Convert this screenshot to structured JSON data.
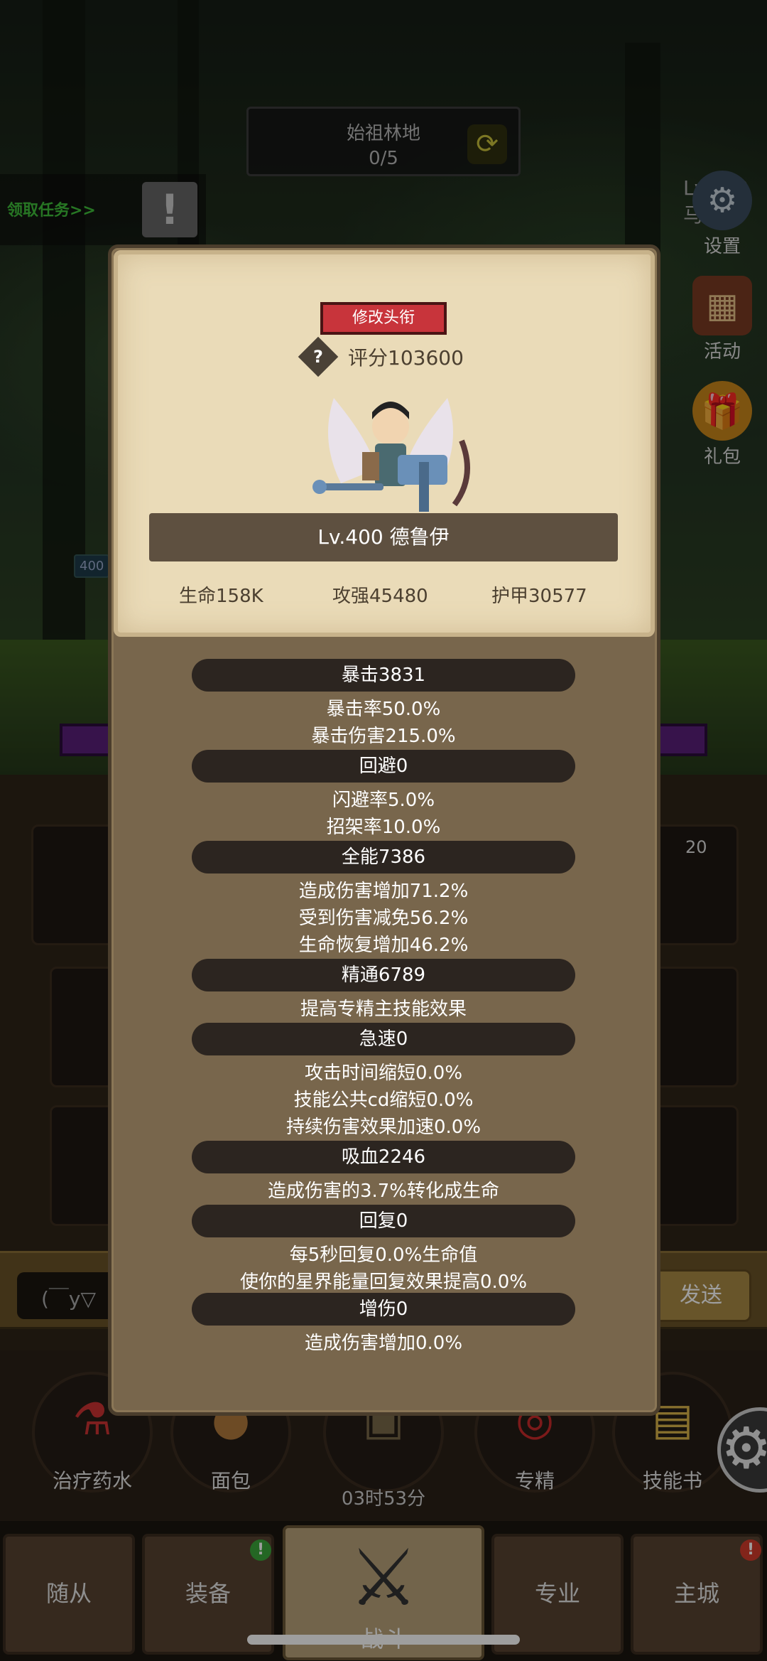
{
  "zone": {
    "title": "始祖林地",
    "progress": "0/5"
  },
  "task": {
    "label": "领取任务>>"
  },
  "player_level": "Lv.352 马",
  "side_menu": [
    {
      "label": "设置"
    },
    {
      "label": "活动"
    },
    {
      "label": "礼包"
    }
  ],
  "scene_badge": "400",
  "slot_count": "20",
  "chat": {
    "input_text": "(￣y▽",
    "send_label": "发送"
  },
  "items": [
    {
      "label": "治疗药水"
    },
    {
      "label": "面包"
    },
    {
      "label": "专精"
    },
    {
      "label": "技能书"
    }
  ],
  "timer": "03时53分",
  "tabs": [
    {
      "label": "随从"
    },
    {
      "label": "装备"
    },
    {
      "label": "战斗"
    },
    {
      "label": "专业"
    },
    {
      "label": "主城"
    }
  ],
  "modal": {
    "rename_label": "修改头衔",
    "score": "评分103600",
    "hero_name": "Lv.400 德鲁伊",
    "top_stats": [
      "生命158K",
      "攻强45480",
      "护甲30577"
    ],
    "sections": [
      {
        "title": "暴击3831",
        "lines": [
          "暴击率50.0%",
          "暴击伤害215.0%"
        ]
      },
      {
        "title": "回避0",
        "lines": [
          "闪避率5.0%",
          "招架率10.0%"
        ]
      },
      {
        "title": "全能7386",
        "lines": [
          "造成伤害增加71.2%",
          "受到伤害减免56.2%",
          "生命恢复增加46.2%"
        ]
      },
      {
        "title": "精通6789",
        "lines": [
          "提高专精主技能效果"
        ]
      },
      {
        "title": "急速0",
        "lines": [
          "攻击时间缩短0.0%",
          "技能公共cd缩短0.0%",
          "持续伤害效果加速0.0%"
        ]
      },
      {
        "title": "吸血2246",
        "lines": [
          "造成伤害的3.7%转化成生命"
        ]
      },
      {
        "title": "回复0",
        "lines": [
          "每5秒回复0.0%生命值",
          "使你的星界能量回复效果提高0.0%"
        ]
      },
      {
        "title": "增伤0",
        "lines": [
          "造成伤害增加0.0%"
        ]
      }
    ]
  },
  "colors": {
    "rename_button": "#c8343b",
    "card_bg": "#eadbb8",
    "panel_bg": "#78664c",
    "section_bar": "#2c2520",
    "task_text": "#3fbf3a"
  }
}
